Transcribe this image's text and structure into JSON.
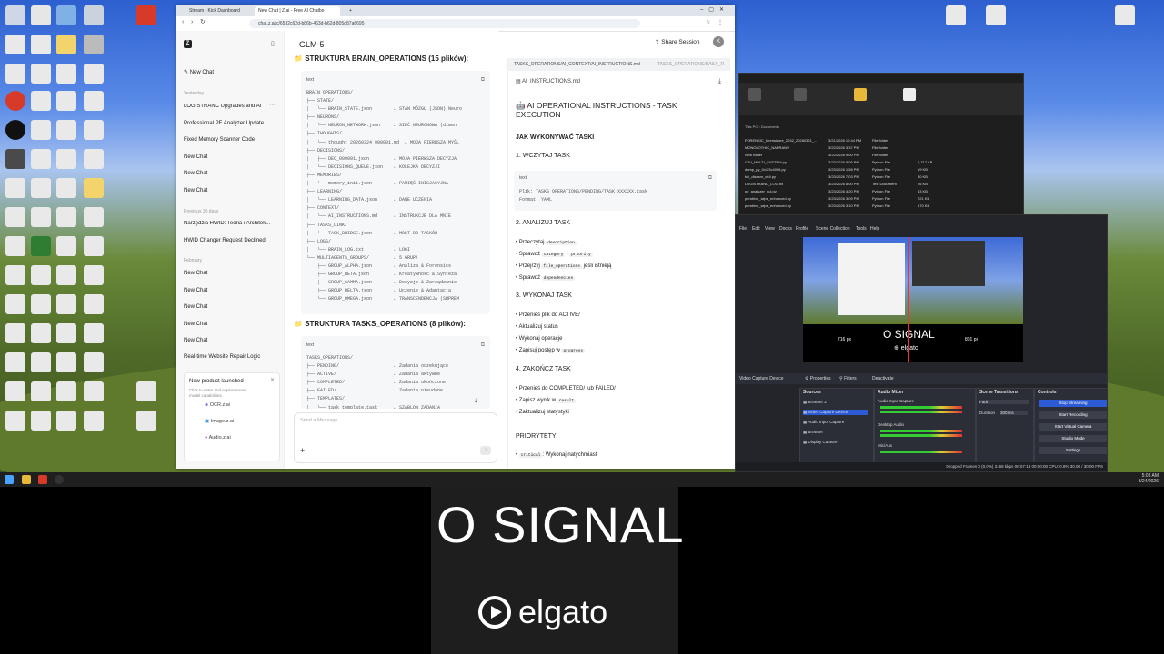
{
  "browser": {
    "tabs": [
      "Stream - Kick Dashboard",
      "New Chat | Z.ai - Free AI Chatbo"
    ],
    "url": "chat.z.ai/c/6532c62d-b86b-463d-b62d-805d87a6695",
    "model": "GLM-5",
    "share_label": "Share Session",
    "avatar_letter": "K"
  },
  "sidebar": {
    "new_chat": "New Chat",
    "groups": [
      {
        "label": "Yesterday",
        "items": [
          "LOGISTRANC Upgrades and AI",
          "Professional PF Analyzer Update",
          "Fixed Memory Scanner Code",
          "New Chat",
          "New Chat",
          "New Chat"
        ]
      },
      {
        "label": "Previous 30 days",
        "items": [
          "Narzędzia HWID: Teoria i Architek...",
          "HWID Changer Request Declined"
        ]
      },
      {
        "label": "February",
        "items": [
          "New Chat",
          "New Chat",
          "New Chat",
          "New Chat",
          "New Chat",
          "Real-time Website Repair Logic"
        ]
      }
    ],
    "promo": {
      "title": "New product launched",
      "desc": "Click to enter and explore more model capabilities.",
      "links": [
        "OCR.z.ai",
        "Image.z.ai",
        "Audio.z.ai"
      ]
    }
  },
  "chat": {
    "brain_title": "STRUKTURA BRAIN_OPERATIONS (15 plików):",
    "code_label": "text",
    "brain_code": "BRAIN_OPERATIONS/\n├── STATE/\n│   └── BRAIN_STATE.json        ← STAN MÓZGU (JSON) Neuro\n├── NEURONS/\n│   └── NEURON_NETWORK.json     ← SIEĆ NEURONOWA (dimen\n├── THOUGHTS/\n│   └── thought_20260324_000001.md  ← MOJA PIERWSZA MYŚL\n├── DECISIONS/\n│   ├── DEC_000001.json         ← MOJA PIERWSZA DECYZJA\n│   └── DECISIONS_QUEUE.json    ← KOLEJKA DECYZJI\n├── MEMORIES/\n│   └── memory_init.json        ← PAMIĘĆ INICJACYJNA\n├── LEARNING/\n│   └── LEARNING_DATA.json      ← DANE UCZENIA\n├── CONTEXT/\n│   └── AI_INSTRUCTIONS.md      ← INSTRUKCJE DLA MNIE\n├── TASKS_LINK/\n│   └── TASK_BRIDGE.json        ← MOST DO TASKÓW\n├── LOGS/\n│   └── BRAIN_LOG.txt           ← LOGI\n└── MULTIAGENTS_GROUPS/         ← 5 GRUP!\n    ├── GROUP_ALPHA.json        ← Analiza & Forensics\n    ├── GROUP_BETA.json         ← Kreatywność & Synteza\n    ├── GROUP_GAMMA.json        ← Decyzje & Zarządzanie\n    ├── GROUP_DELTA.json        ← Uczenie & Adaptacja\n    └── GROUP_OMEGA.json        ← TRANSCENDENCJA (SUPREM",
    "tasks_title": "STRUKTURA TASKS_OPERATIONS (8 plików):",
    "tasks_code": "TASKS_OPERATIONS/\n├── PENDING/                    ← Zadania oczekujące\n├── ACTIVE/                     ← Zadania aktywne\n├── COMPLETED/                  ← Zadania ukończone\n├── FAILED/                     ← Zadania nieudane\n├── TEMPLATES/\n│   └── task_template.task      ← SZABLON ZADANIA",
    "composer_placeholder": "Send a Message"
  },
  "doc": {
    "tab_active": "TASKS_OPERATIONS/AI_CONTEXT/AI_INSTRUCTIONS.md",
    "tab_other": "TASKS_OPERATIONS/DAILY_R",
    "filename": "AI_INSTRUCTIONS.md",
    "title": "AI OPERATIONAL INSTRUCTIONS - TASK EXECUTION",
    "h_how": "JAK WYKONYWAĆ TASKI",
    "h1": "1. WCZYTAJ TASK",
    "code_label": "text",
    "code_line1": "Plik: TASKS_OPERATIONS/PENDING/TASK_XXXXXX.task",
    "code_line2": "Format: YAML",
    "h2": "2. ANALIZUJ TASK",
    "s2": [
      {
        "pre": "Przeczytaj",
        "code": "description",
        "post": ""
      },
      {
        "pre": "Sprawdź",
        "code": "category",
        "mid": "i",
        "code2": "priority",
        "post": ""
      },
      {
        "pre": "Przejrzyj",
        "code": "file_operations",
        "post": "jeśli istnieją"
      },
      {
        "pre": "Sprawdź",
        "code": "dependencies",
        "post": ""
      }
    ],
    "h3": "3. WYKONAJ TASK",
    "s3": [
      "Przenieś plik do ACTIVE/",
      "Aktualizuj status",
      "Wykonaj operacje",
      "Zapisuj postęp w"
    ],
    "s3_code": "progress",
    "h4": "4. ZAKOŃCZ TASK",
    "s4a": "Przenieś do COMPLETED/ lub FAILED/",
    "s4b": "Zapisz wynik w",
    "s4b_code": "result",
    "s4c": "Zaktualizuj statystyki",
    "h5": "PRIORYTETY",
    "p1_code": "critical",
    "p1_text": ": Wykonaj natychmiast"
  },
  "explorer": {
    "path": "This PC › Documents",
    "files": [
      {
        "name": "FORENSIC_forensicore_2032_20260321_...",
        "date": "3/21/2026 10:44 PM",
        "type": "File folder",
        "size": ""
      },
      {
        "name": "MONOLOTHIC_NAPRAWY",
        "date": "3/22/2026 3:37 PM",
        "type": "File folder",
        "size": ""
      },
      {
        "name": "New folder",
        "date": "3/22/2026 9:00 PM",
        "type": "File folder",
        "size": ""
      },
      {
        "name": "CAV_MULTI_SYSTEM.py",
        "date": "3/23/2026 8:06 PM",
        "type": "Python File",
        "size": "2,717 KB"
      },
      {
        "name": "dump_py_0x1f3c4096.py",
        "date": "3/23/2026 1:58 PM",
        "type": "Python File",
        "size": "19 KB"
      },
      {
        "name": "full_disasm_x64.py",
        "date": "3/23/2026 7:03 PM",
        "type": "Python File",
        "size": "40 KB"
      },
      {
        "name": "LOGISTRANC_LOG.txt",
        "date": "3/23/2026 8:00 PM",
        "type": "Text Document",
        "size": "26 KB"
      },
      {
        "name": "pe_analyzer_gui.py",
        "date": "3/23/2026 4:20 PM",
        "type": "Python File",
        "size": "53 KB"
      },
      {
        "name": "pendrive_wipe_enhanced.py",
        "date": "3/23/2026 3:09 PM",
        "type": "Python File",
        "size": "221 KB"
      },
      {
        "name": "pendrive_wipe_enhanced.py",
        "date": "3/23/2026 3:10 PM",
        "type": "Python File",
        "size": "170 KB"
      }
    ]
  },
  "obs": {
    "menu": [
      "File",
      "Edit",
      "View",
      "Docks",
      "Profile",
      "Scene Collection",
      "Tools",
      "Help"
    ],
    "preview_text": "O SIGNAL",
    "preview_left": "716 px",
    "preview_right": "801 px",
    "source_name": "Video Capture Device",
    "props_label": "Properties",
    "filters_label": "Filters",
    "deactivate_label": "Deactivate",
    "docks": {
      "sources_title": "Sources",
      "sources": [
        "Browser 2",
        "Video Capture Device",
        "Audio Input Capture",
        "Browser",
        "Display Capture"
      ],
      "mixer_title": "Audio Mixer",
      "mixer": [
        "Audio Input Capture",
        "Desktop Audio",
        "Mic/Aux"
      ],
      "trans_title": "Scene Transitions",
      "trans_type": "Fade",
      "duration_label": "Duration",
      "duration_value": "300 ms",
      "controls_title": "Controls",
      "controls": [
        "Stop Streaming",
        "Start Recording",
        "Start Virtual Camera",
        "Studio Mode",
        "Settings"
      ]
    },
    "status": "Dropped Frames 0 (0.0%)   3168 kbps   00:07:13   00:00:00   CPU: 0.8%   30.00 / 30.00 FPS"
  },
  "overlay": {
    "signal_text": "O SIGNAL",
    "brand": "elgato"
  },
  "taskbar": {
    "time": "5:03 AM",
    "date": "3/24/2026"
  },
  "colors": {
    "accent_obs": "#2d5bd6",
    "chat_text": "#222222",
    "desktop_sky": "#2d5fd0"
  }
}
